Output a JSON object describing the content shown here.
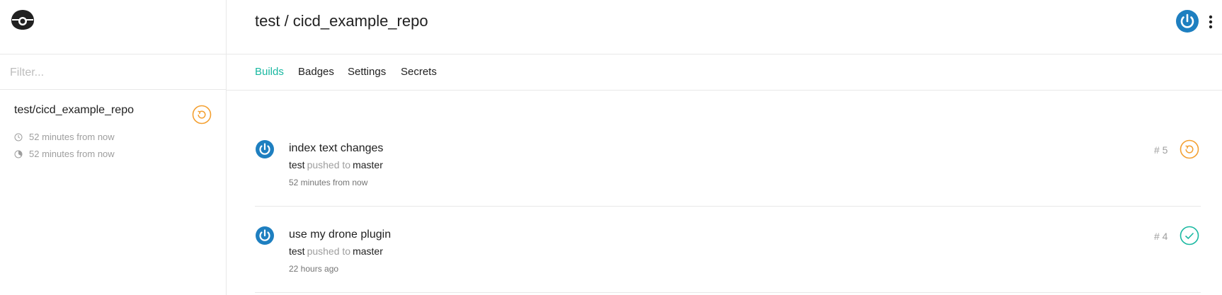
{
  "colors": {
    "accent": "#19b8a1",
    "pending": "#f4a031",
    "success": "#19b8a1",
    "avatar": "#1e7fc0",
    "border": "#e8e8e8",
    "muted": "#9e9e9e"
  },
  "sidebar": {
    "logo_icon": "drone-logo-icon",
    "filter": {
      "placeholder": "Filter...",
      "value": ""
    },
    "repos": [
      {
        "name": "test/cicd_example_repo",
        "status": "pending",
        "status_icon": "refresh-circle-icon",
        "started": "52 minutes from now",
        "started_icon": "clock-icon",
        "finished": "52 minutes from now",
        "finished_icon": "timer-icon"
      }
    ]
  },
  "header": {
    "title": "test / cicd_example_repo",
    "user_icon": "power-avatar-icon",
    "menu_icon": "more-vertical-icon"
  },
  "tabs": [
    {
      "label": "Builds",
      "active": true
    },
    {
      "label": "Badges",
      "active": false
    },
    {
      "label": "Settings",
      "active": false
    },
    {
      "label": "Secrets",
      "active": false
    }
  ],
  "builds": [
    {
      "message": "index text changes",
      "author": "test",
      "action": "pushed to",
      "branch": "master",
      "time": "52 minutes from now",
      "number": "# 5",
      "status": "pending",
      "status_icon": "refresh-circle-icon"
    },
    {
      "message": "use my drone plugin",
      "author": "test",
      "action": "pushed to",
      "branch": "master",
      "time": "22 hours ago",
      "number": "# 4",
      "status": "success",
      "status_icon": "check-circle-icon"
    }
  ]
}
